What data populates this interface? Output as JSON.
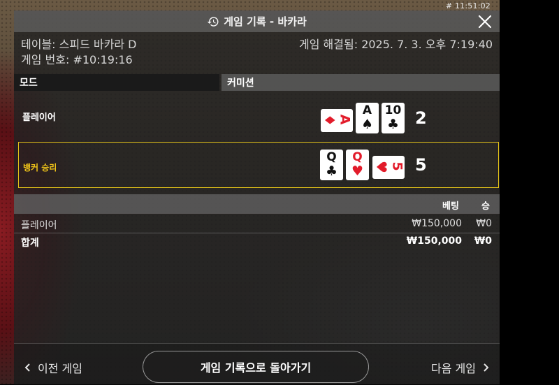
{
  "clock": "# 11:51:02",
  "header": {
    "title": "게임 기록 - 바카라"
  },
  "info": {
    "table_label": "테이블: 스피드 바카라 D",
    "game_number": "게임 번호: #10:19:16",
    "resolved": "게임 해결됨: 2025. 7. 3. 오후 7:19:40"
  },
  "columns": {
    "mode": "모드",
    "commission": "커미션"
  },
  "hands": [
    {
      "label": "플레이어",
      "score": "2",
      "cards": [
        {
          "rank": "A",
          "suit": "♦",
          "color": "#e21b2a",
          "orientation": "side"
        },
        {
          "rank": "A",
          "suit": "♠",
          "color": "#111111",
          "orientation": "up"
        },
        {
          "rank": "10",
          "suit": "♣",
          "color": "#111111",
          "orientation": "up"
        }
      ]
    },
    {
      "label": "뱅커 승리",
      "score": "5",
      "cards": [
        {
          "rank": "Q",
          "suit": "♣",
          "color": "#111111",
          "orientation": "up"
        },
        {
          "rank": "Q",
          "suit": "♥",
          "color": "#e21b2a",
          "orientation": "up"
        },
        {
          "rank": "5",
          "suit": "♥",
          "color": "#e21b2a",
          "orientation": "side"
        }
      ]
    }
  ],
  "bets": {
    "header": {
      "bet": "베팅",
      "win": "승"
    },
    "rows": [
      {
        "label": "플레이어",
        "bet": "₩150,000",
        "win": "₩0"
      }
    ],
    "total": {
      "label": "합계",
      "bet": "₩150,000",
      "win": "₩0"
    }
  },
  "footer": {
    "prev": "이전 게임",
    "back": "게임 기록으로 돌아가기",
    "next": "다음 게임"
  },
  "colors": {
    "banker_highlight": "#e4c318",
    "red_suit": "#e21b2a"
  }
}
